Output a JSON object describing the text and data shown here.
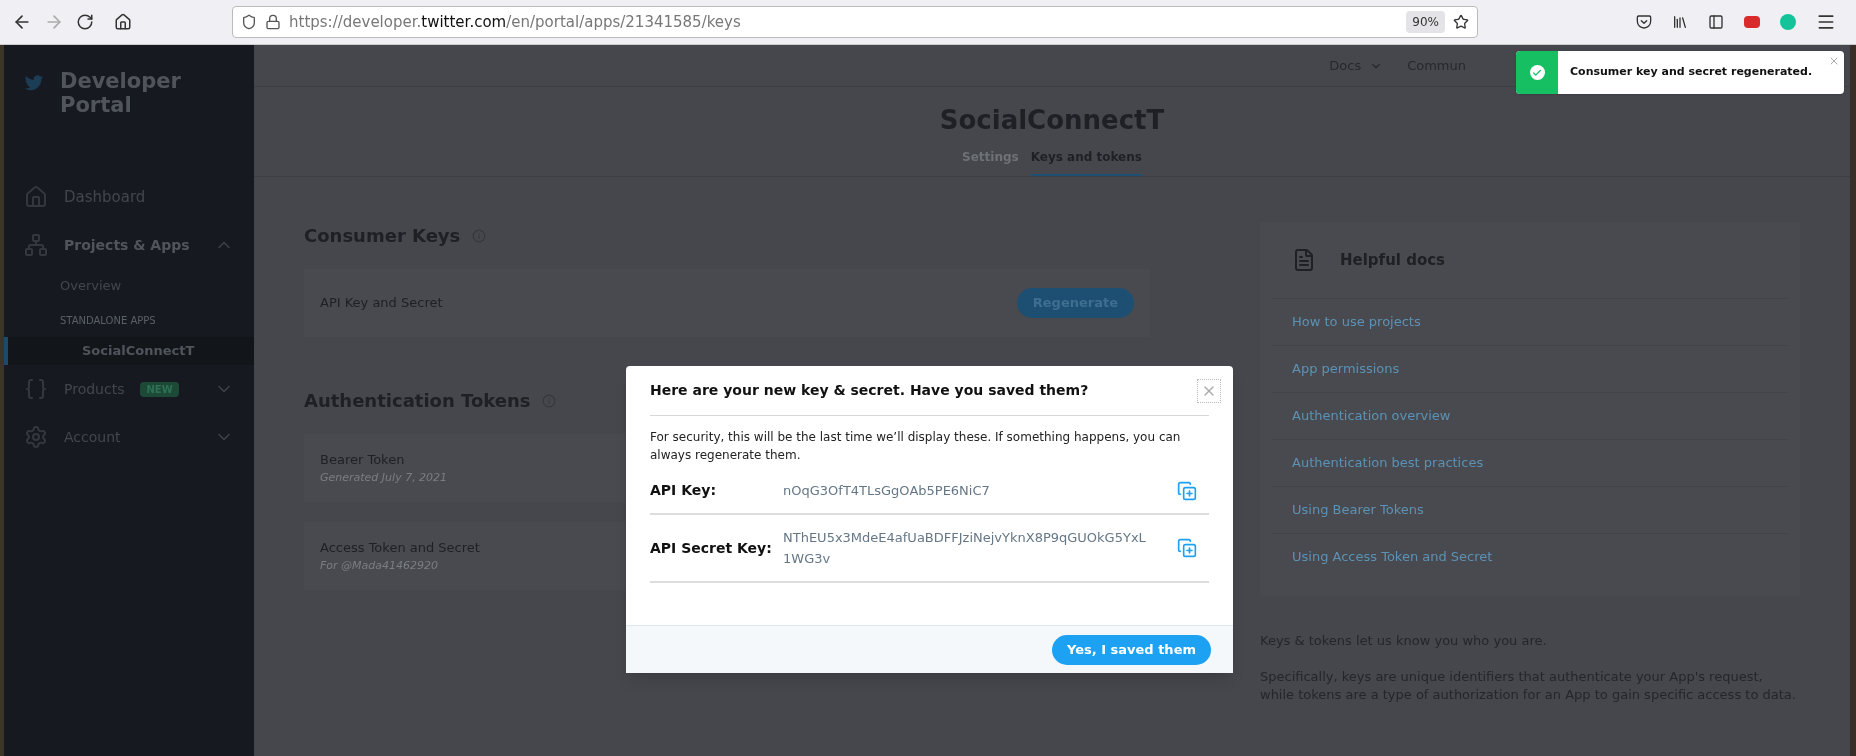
{
  "browser": {
    "url_prefix": "https://developer.",
    "url_host": "twitter.com",
    "url_path": "/en/portal/apps/21341585/keys",
    "zoom": "90%"
  },
  "sidebar": {
    "title": "Developer Portal",
    "items": [
      {
        "kind": "link",
        "label": "Dashboard"
      },
      {
        "kind": "group",
        "label": "Projects & Apps",
        "expanded": true,
        "children": [
          {
            "kind": "sub",
            "label": "Overview",
            "selected": false
          },
          {
            "kind": "section",
            "label": "STANDALONE APPS"
          },
          {
            "kind": "app",
            "label": "SocialConnectT",
            "selected": true
          }
        ]
      },
      {
        "kind": "group",
        "label": "Products",
        "badge": "NEW",
        "expanded": false
      },
      {
        "kind": "group",
        "label": "Account",
        "expanded": false
      }
    ]
  },
  "top_nav": [
    {
      "kind": "menu",
      "label": "Docs"
    },
    {
      "kind": "text",
      "label": "Commun"
    }
  ],
  "app_title": "SocialConnectT",
  "tabs": [
    {
      "label": "Settings",
      "selected": false
    },
    {
      "label": "Keys and tokens",
      "selected": true
    }
  ],
  "sections": [
    {
      "title": "Consumer Keys",
      "rows": [
        {
          "title": "API Key and Secret",
          "button": "Regenerate"
        }
      ]
    },
    {
      "title": "Authentication Tokens",
      "rows": [
        {
          "title": "Bearer Token",
          "subtitle": "Generated July 7, 2021"
        },
        {
          "title": "Access Token and Secret",
          "subtitle": "For @Mada41462920"
        }
      ]
    }
  ],
  "helpful_docs": {
    "title": "Helpful docs",
    "links": [
      "How to use projects",
      "App permissions",
      "Authentication overview",
      "Authentication best practices",
      "Using Bearer Tokens",
      "Using Access Token and Secret"
    ],
    "paragraphs": [
      "Keys & tokens let us know you who you are.",
      "Specifically, keys are unique identifiers that authenticate your App's request, while tokens are a type of authorization for an App to gain specific access to data."
    ]
  },
  "modal": {
    "title": "Here are your new key & secret. Have you saved them?",
    "body": "For security, this will be the last time we’ll display these. If something happens, you can always regenerate them.",
    "keys": [
      {
        "label": "API Key:",
        "value": "nOqG3OfT4TLsGgOAb5PE6NiC7"
      },
      {
        "label": "API Secret Key:",
        "value": "NThEU5x3MdeE4afUaBDFFJziNejvYknX8P9qGUOkG5YxL1WG3v"
      }
    ],
    "button": "Yes, I saved them"
  },
  "toast": {
    "message": "Consumer key and secret regenerated."
  }
}
